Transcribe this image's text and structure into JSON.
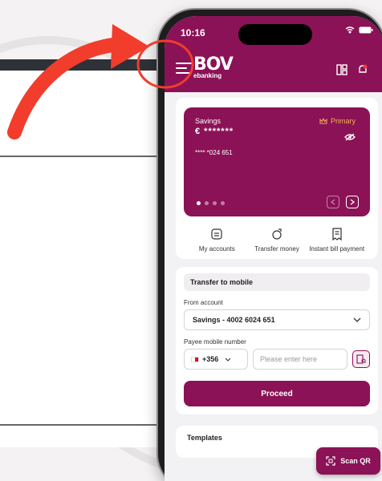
{
  "status_bar": {
    "time": "10:16"
  },
  "header": {
    "logo_text": "BOV",
    "logo_subtext": "ebanking",
    "menu_icon": "hamburger-menu-icon",
    "right_icons": [
      "grid-view-icon",
      "notification-bell-icon"
    ]
  },
  "card": {
    "type": "Savings",
    "primary_label": "Primary",
    "balance": "€ *******",
    "number": "**** *024 651",
    "pager_count": 4,
    "pager_active": 1
  },
  "actions": [
    {
      "label": "My accounts",
      "icon": "accounts-icon"
    },
    {
      "label": "Transfer money",
      "icon": "transfer-money-icon"
    },
    {
      "label": "Instant bill payment",
      "icon": "bill-payment-icon"
    }
  ],
  "transfer": {
    "title": "Transfer to mobile",
    "from_label": "From account",
    "from_value": "Savings - 4002 6024 651",
    "payee_label": "Payee mobile number",
    "country_code": "+356",
    "mobile_placeholder": "Please enter here",
    "proceed_label": "Proceed"
  },
  "templates": {
    "title": "Templates"
  },
  "scan_qr": {
    "label": "Scan QR"
  },
  "colors": {
    "brand": "#8b1256",
    "arrow_red": "#f23c2c",
    "primary_gold": "#f1b54a"
  }
}
